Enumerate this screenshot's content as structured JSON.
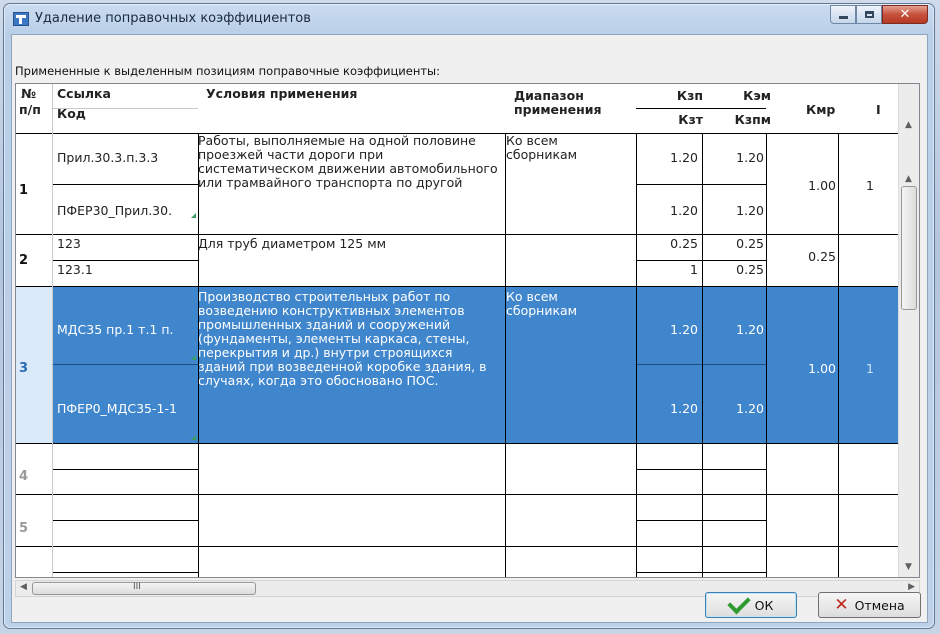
{
  "window": {
    "title": "Удаление поправочных коэффициентов"
  },
  "caption": "Примененные к выделенным позициям поправочные коэффициенты:",
  "columns": {
    "no_a": "№",
    "no_b": "п/п",
    "link": "Ссылка",
    "code": "Код",
    "conditions": "Условия применения",
    "range_a": "Диапазон",
    "range_b": "применения",
    "kzp": "Кзп",
    "kem": "Кэм",
    "kzt": "Кзт",
    "kzpm": "Кзпм",
    "kmr": "Кмр",
    "more": "I"
  },
  "rows": [
    {
      "n": "1",
      "link": "Прил.30.3.п.3.3",
      "code": "ПФЕР30_Прил.30.",
      "conditions": "Работы, выполняемые на одной половине проезжей части дороги при систематическом движении автомобильного или трамвайного транспорта по другой",
      "range": "Ко всем сборникам",
      "kzp": "1.20",
      "kem": "1.20",
      "kzt": "1.20",
      "kzpm": "1.20",
      "kmr": "1.00",
      "more": "1"
    },
    {
      "n": "2",
      "link": "123",
      "code": "123.1",
      "conditions": "Для труб диаметром 125 мм",
      "range": "",
      "kzp": "0.25",
      "kem": "0.25",
      "kzt": "1",
      "kzpm": "0.25",
      "kmr": "0.25",
      "more": ""
    },
    {
      "n": "3",
      "link": "МДС35 пр.1 т.1 п.",
      "code": "ПФЕР0_МДС35-1-1",
      "conditions": "Производство строительных работ по возведению конструктивных элементов промышленных зданий и сооружений (фундаменты, элементы каркаса, стены, перекрытия и др.) внутри строящихся зданий при возведенной коробке здания, в случаях, когда это обосновано ПОС.",
      "range": "Ко всем сборникам",
      "kzp": "1.20",
      "kem": "1.20",
      "kzt": "1.20",
      "kzpm": "1.20",
      "kmr": "1.00",
      "more": "1"
    },
    {
      "n": "4"
    },
    {
      "n": "5"
    }
  ],
  "buttons": {
    "ok": "ОК",
    "cancel": "Отмена"
  },
  "hscroll_grip": "III"
}
